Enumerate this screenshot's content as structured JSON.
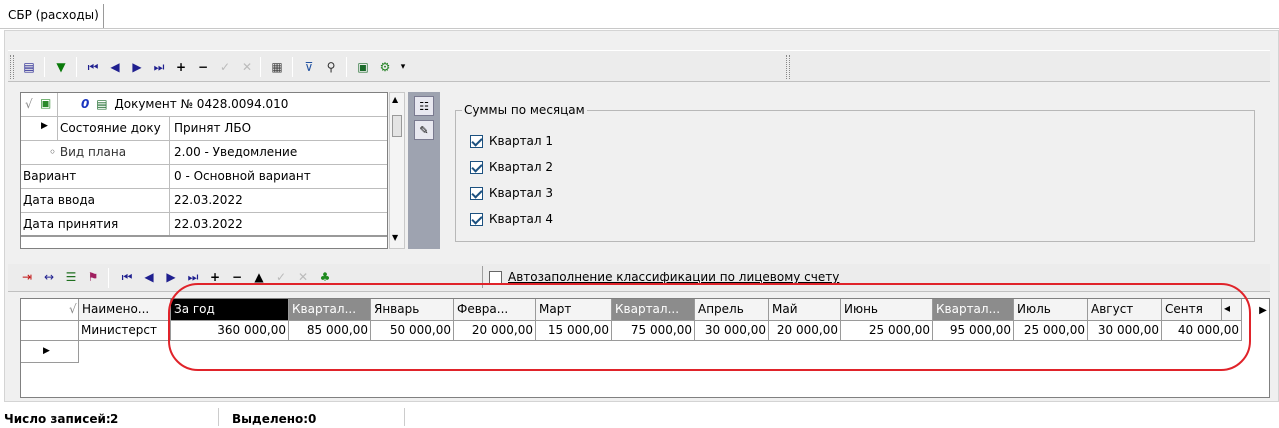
{
  "tab": {
    "title": "СБР (расходы)"
  },
  "toolbar": {
    "icons": [
      "copy-icon",
      "green-filter-icon",
      "first-icon",
      "prev-icon",
      "next-icon",
      "last-icon",
      "add-icon",
      "delete-icon",
      "confirm-icon",
      "cancel-icon",
      "calculator-icon",
      "filter-icon",
      "find-icon",
      "card-icon",
      "tools-icon"
    ]
  },
  "document": {
    "header": "Документ № 0428.0094.010",
    "header_count": "0",
    "rows": [
      {
        "label": "Состояние доку",
        "value": "Принят ЛБО"
      },
      {
        "label": "◦ Вид плана",
        "value": "2.00 - Уведомление"
      },
      {
        "label": "Вариант",
        "value": "0 - Основной вариант"
      },
      {
        "label": "Дата ввода",
        "value": "22.03.2022"
      },
      {
        "label": "Дата принятия",
        "value": "22.03.2022"
      }
    ]
  },
  "months_group": {
    "title": "Суммы по месяцам",
    "quarters": [
      "Квартал 1",
      "Квартал 2",
      "Квартал 3",
      "Квартал 4"
    ]
  },
  "autofill": {
    "label": "Автозаполнение классификации по лицевому счету"
  },
  "grid": {
    "headers": [
      "Наимено...",
      "За год",
      "Квартал...",
      "Январь",
      "Февра...",
      "Март",
      "Квартал...",
      "Апрель",
      "Май",
      "Июнь",
      "Квартал...",
      "Июль",
      "Август",
      "Сентя"
    ],
    "row": [
      "Министерст",
      "360 000,00",
      "85 000,00",
      "50 000,00",
      "20 000,00",
      "15 000,00",
      "75 000,00",
      "30 000,00",
      "20 000,00",
      "25 000,00",
      "95 000,00",
      "25 000,00",
      "30 000,00",
      "40 000,00"
    ]
  },
  "status": {
    "records_label": "Число записей:",
    "records_value": "2",
    "selected_label": "Выделено:",
    "selected_value": "0"
  },
  "colors": {
    "highlight": "#e0232a",
    "accent_header": "#000000",
    "quarter_header": "#8c8c8c"
  }
}
